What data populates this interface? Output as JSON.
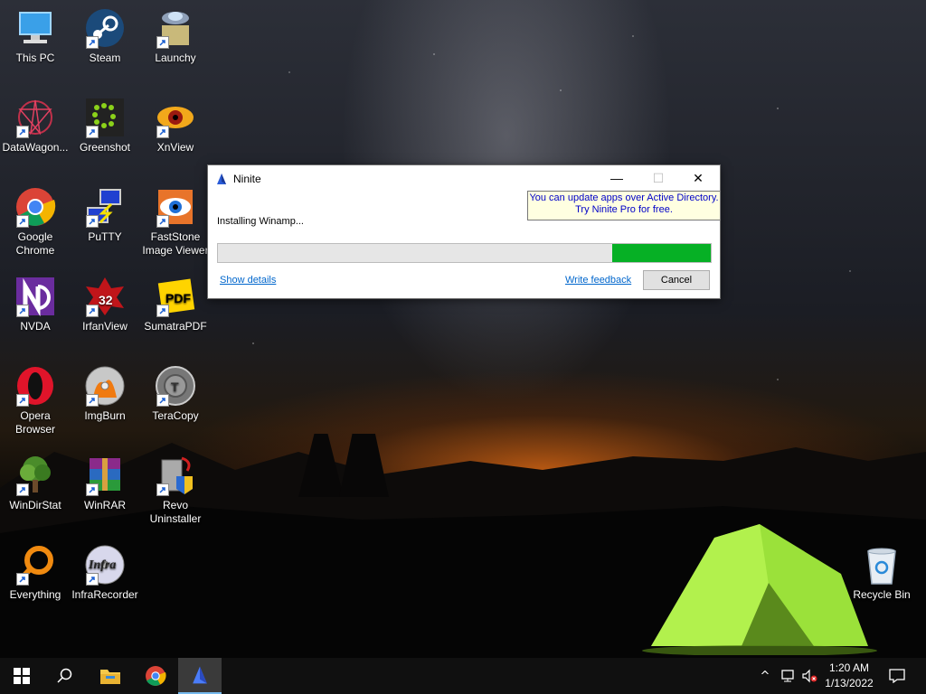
{
  "desktop": {
    "icons": [
      {
        "label": "This PC"
      },
      {
        "label": "Steam"
      },
      {
        "label": "Launchy"
      },
      {
        "label": "DataWagon..."
      },
      {
        "label": "Greenshot"
      },
      {
        "label": "XnView"
      },
      {
        "label": "Google Chrome"
      },
      {
        "label": "PuTTY"
      },
      {
        "label": "FastStone Image Viewer"
      },
      {
        "label": "NVDA"
      },
      {
        "label": "IrfanView"
      },
      {
        "label": "SumatraPDF"
      },
      {
        "label": "Opera Browser"
      },
      {
        "label": "ImgBurn"
      },
      {
        "label": "TeraCopy"
      },
      {
        "label": "WinDirStat"
      },
      {
        "label": "WinRAR"
      },
      {
        "label": "Revo Uninstaller"
      },
      {
        "label": "Everything"
      },
      {
        "label": "InfraRecorder"
      },
      {
        "label": "Recycle Bin"
      }
    ],
    "irfan_badge": "32",
    "pdf_badge": "PDF",
    "infra_text": "Infra"
  },
  "dialog": {
    "title": "Ninite",
    "minimize": "—",
    "maximize": "☐",
    "close": "✕",
    "tip_line1": "You can update apps over Active Directory.",
    "tip_line2": "Try Ninite Pro for free.",
    "status": "Installing Winamp...",
    "progress_fraction": 0.8,
    "show_details": "Show details",
    "write_feedback": "Write feedback",
    "cancel": "Cancel"
  },
  "taskbar": {
    "time": "1:20 AM",
    "date": "1/13/2022",
    "tray_chevron": "^"
  },
  "colors": {
    "progress_fill": "#06b025",
    "tip_text": "#0000c8",
    "link": "#0066cc"
  }
}
